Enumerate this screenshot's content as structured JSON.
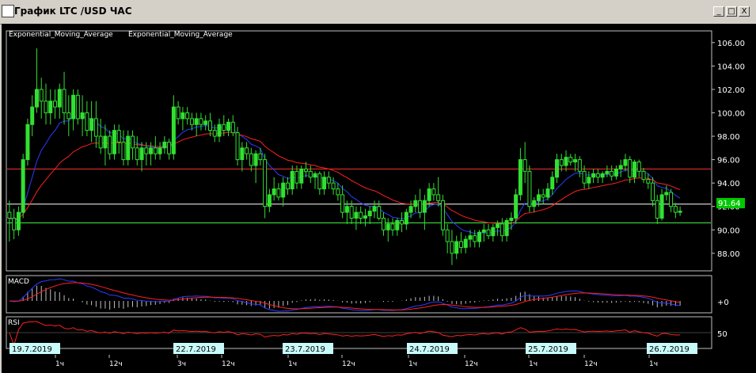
{
  "window": {
    "title": "График LTC /USD  ЧАС",
    "buttons": [
      "_",
      "□",
      "X"
    ]
  },
  "main_panel": {
    "legend": [
      {
        "name": "Exponential_Moving_Average",
        "color": "#2a3cff"
      },
      {
        "name": "Exponential_Moving_Average",
        "color": "#ff2020"
      }
    ],
    "y_ticks": [
      "106.00",
      "104.00",
      "102.00",
      "100.00",
      "98.00",
      "96.00",
      "94.00",
      "92.00",
      "90.00",
      "88.00"
    ],
    "current_price": "91.64",
    "hlines": [
      {
        "value": 95.2,
        "color": "#ff3030"
      },
      {
        "value": 92.2,
        "color": "#ffffff"
      },
      {
        "value": 90.6,
        "color": "#40ff40"
      }
    ]
  },
  "macd_panel": {
    "label": "MACD",
    "tick": "+0"
  },
  "rsi_panel": {
    "label": "RSI",
    "tick": "50"
  },
  "x_axis": {
    "dates": [
      "19.7.2019",
      "22.7.2019",
      "23.7.2019",
      "24.7.2019",
      "25.7.2019",
      "26.7.2019"
    ],
    "times": [
      "1ч",
      "12ч",
      "3ч",
      "12ч",
      "1ч",
      "12ч",
      "1ч",
      "12ч",
      "1ч",
      "12ч",
      "1ч"
    ]
  },
  "chart_data": {
    "type": "candlestick",
    "ylim": [
      86.5,
      107
    ],
    "candles": [
      [
        91.5,
        92.5,
        89.0,
        91.0
      ],
      [
        91.0,
        91.8,
        89.2,
        90.0
      ],
      [
        90.0,
        92.0,
        89.5,
        91.5
      ],
      [
        91.5,
        96.5,
        91.0,
        96.0
      ],
      [
        96.0,
        99.5,
        95.5,
        99.0
      ],
      [
        99.0,
        101.5,
        98.0,
        100.5
      ],
      [
        100.5,
        105.5,
        100.0,
        102.0
      ],
      [
        102.0,
        103.0,
        99.5,
        101.0
      ],
      [
        101.0,
        102.5,
        99.0,
        100.0
      ],
      [
        100.0,
        102.0,
        99.0,
        101.0
      ],
      [
        101.0,
        102.0,
        99.5,
        100.5
      ],
      [
        100.5,
        102.5,
        99.5,
        102.0
      ],
      [
        102.0,
        103.5,
        99.0,
        100.0
      ],
      [
        100.0,
        101.5,
        98.0,
        99.5
      ],
      [
        99.5,
        102.0,
        98.5,
        101.5
      ],
      [
        101.5,
        102.0,
        99.0,
        99.5
      ],
      [
        99.5,
        101.5,
        98.0,
        100.0
      ],
      [
        100.0,
        101.0,
        98.0,
        98.5
      ],
      [
        98.5,
        101.0,
        97.5,
        99.5
      ],
      [
        99.5,
        101.0,
        97.0,
        98.0
      ],
      [
        98.0,
        99.5,
        96.5,
        97.0
      ],
      [
        97.0,
        99.0,
        95.5,
        98.0
      ],
      [
        98.0,
        98.5,
        96.0,
        96.5
      ],
      [
        96.5,
        99.0,
        96.0,
        98.5
      ],
      [
        98.5,
        99.0,
        96.5,
        97.5
      ],
      [
        97.5,
        98.5,
        95.5,
        96.0
      ],
      [
        96.0,
        98.5,
        95.5,
        98.0
      ],
      [
        98.0,
        98.5,
        96.0,
        97.0
      ],
      [
        97.0,
        98.0,
        95.5,
        96.0
      ],
      [
        96.0,
        97.5,
        95.0,
        97.0
      ],
      [
        97.0,
        97.5,
        95.5,
        96.5
      ],
      [
        96.5,
        97.5,
        95.5,
        97.0
      ],
      [
        97.0,
        98.0,
        96.0,
        96.5
      ],
      [
        96.5,
        97.5,
        96.0,
        97.0
      ],
      [
        97.0,
        98.0,
        96.5,
        97.5
      ],
      [
        97.5,
        97.8,
        96.0,
        96.5
      ],
      [
        96.5,
        101.5,
        96.0,
        100.5
      ],
      [
        100.5,
        101.0,
        99.0,
        99.5
      ],
      [
        99.5,
        100.5,
        98.5,
        100.0
      ],
      [
        100.0,
        100.5,
        99.0,
        99.5
      ],
      [
        99.5,
        100.0,
        98.5,
        99.0
      ],
      [
        99.0,
        100.0,
        98.0,
        99.5
      ],
      [
        99.5,
        100.0,
        98.5,
        99.0
      ],
      [
        99.0,
        99.8,
        98.5,
        99.3
      ],
      [
        99.3,
        100.0,
        98.0,
        98.5
      ],
      [
        98.5,
        99.0,
        97.5,
        98.0
      ],
      [
        98.0,
        99.5,
        97.5,
        99.0
      ],
      [
        99.0,
        99.8,
        98.0,
        98.5
      ],
      [
        98.5,
        99.5,
        98.0,
        99.2
      ],
      [
        99.2,
        99.8,
        98.0,
        98.3
      ],
      [
        98.3,
        98.8,
        95.5,
        96.0
      ],
      [
        96.0,
        97.5,
        95.0,
        97.0
      ],
      [
        97.0,
        97.5,
        96.0,
        96.5
      ],
      [
        96.5,
        97.0,
        95.0,
        95.5
      ],
      [
        95.5,
        96.8,
        94.0,
        96.5
      ],
      [
        96.5,
        97.0,
        95.5,
        96.0
      ],
      [
        96.0,
        96.5,
        91.0,
        92.0
      ],
      [
        92.0,
        93.5,
        91.5,
        93.0
      ],
      [
        93.0,
        94.5,
        92.5,
        93.5
      ],
      [
        93.5,
        94.0,
        92.5,
        92.8
      ],
      [
        92.8,
        94.5,
        92.0,
        94.0
      ],
      [
        94.0,
        94.5,
        93.0,
        93.5
      ],
      [
        93.5,
        95.5,
        93.0,
        95.0
      ],
      [
        95.0,
        95.5,
        93.5,
        94.0
      ],
      [
        94.0,
        95.5,
        93.5,
        95.2
      ],
      [
        95.2,
        95.8,
        94.5,
        95.0
      ],
      [
        95.0,
        95.5,
        94.0,
        94.5
      ],
      [
        94.5,
        95.0,
        93.5,
        94.8
      ],
      [
        94.8,
        95.0,
        93.0,
        93.5
      ],
      [
        93.5,
        95.0,
        93.0,
        94.5
      ],
      [
        94.5,
        95.0,
        93.5,
        94.0
      ],
      [
        94.0,
        94.5,
        93.0,
        93.5
      ],
      [
        93.5,
        94.0,
        92.5,
        93.0
      ],
      [
        93.0,
        93.8,
        91.0,
        91.5
      ],
      [
        91.5,
        92.5,
        90.5,
        92.0
      ],
      [
        92.0,
        92.5,
        90.5,
        91.0
      ],
      [
        91.0,
        92.0,
        90.0,
        91.5
      ],
      [
        91.5,
        92.0,
        90.5,
        91.0
      ],
      [
        91.0,
        91.8,
        90.3,
        91.2
      ],
      [
        91.2,
        92.0,
        90.5,
        91.6
      ],
      [
        91.6,
        92.5,
        91.0,
        92.0
      ],
      [
        92.0,
        92.5,
        90.8,
        91.0
      ],
      [
        91.0,
        91.5,
        89.5,
        90.0
      ],
      [
        90.0,
        91.0,
        89.0,
        90.5
      ],
      [
        90.5,
        91.0,
        89.5,
        90.0
      ],
      [
        90.0,
        91.0,
        89.5,
        90.8
      ],
      [
        90.8,
        91.5,
        89.8,
        90.5
      ],
      [
        90.5,
        91.8,
        90.0,
        91.5
      ],
      [
        91.5,
        92.5,
        91.0,
        92.0
      ],
      [
        92.0,
        93.0,
        91.5,
        92.5
      ],
      [
        92.5,
        93.5,
        91.0,
        91.5
      ],
      [
        91.5,
        93.0,
        90.0,
        92.5
      ],
      [
        92.5,
        94.0,
        92.0,
        93.5
      ],
      [
        93.5,
        94.0,
        92.5,
        93.0
      ],
      [
        93.0,
        94.5,
        92.0,
        92.5
      ],
      [
        92.5,
        93.0,
        89.5,
        90.0
      ],
      [
        90.0,
        90.5,
        88.0,
        89.0
      ],
      [
        89.0,
        90.0,
        87.0,
        88.0
      ],
      [
        88.0,
        89.5,
        87.5,
        89.0
      ],
      [
        89.0,
        89.8,
        88.0,
        88.5
      ],
      [
        88.5,
        89.5,
        88.0,
        89.2
      ],
      [
        89.2,
        90.0,
        88.5,
        89.5
      ],
      [
        89.5,
        90.0,
        88.5,
        89.0
      ],
      [
        89.0,
        90.0,
        88.5,
        89.8
      ],
      [
        89.8,
        90.5,
        89.0,
        90.0
      ],
      [
        90.0,
        90.5,
        89.2,
        89.5
      ],
      [
        89.5,
        90.5,
        89.0,
        90.2
      ],
      [
        90.2,
        90.8,
        89.5,
        90.5
      ],
      [
        90.5,
        91.0,
        89.0,
        89.5
      ],
      [
        89.5,
        91.0,
        89.0,
        90.8
      ],
      [
        90.8,
        91.5,
        90.0,
        91.0
      ],
      [
        91.0,
        93.5,
        90.5,
        93.0
      ],
      [
        93.0,
        97.0,
        92.5,
        96.0
      ],
      [
        96.0,
        97.5,
        94.0,
        95.0
      ],
      [
        95.0,
        95.5,
        91.5,
        92.0
      ],
      [
        92.0,
        92.8,
        91.5,
        92.5
      ],
      [
        92.5,
        93.5,
        92.0,
        93.0
      ],
      [
        93.0,
        93.5,
        92.2,
        92.8
      ],
      [
        92.8,
        94.0,
        92.5,
        93.5
      ],
      [
        93.5,
        95.0,
        93.0,
        94.5
      ],
      [
        94.5,
        96.5,
        94.0,
        96.0
      ],
      [
        96.0,
        96.5,
        95.0,
        95.5
      ],
      [
        95.5,
        96.8,
        95.0,
        96.2
      ],
      [
        96.2,
        96.5,
        95.5,
        95.8
      ],
      [
        95.8,
        96.5,
        95.0,
        96.0
      ],
      [
        96.0,
        96.3,
        94.5,
        95.0
      ],
      [
        95.0,
        95.5,
        93.5,
        94.0
      ],
      [
        94.0,
        95.0,
        93.5,
        94.5
      ],
      [
        94.5,
        95.2,
        94.0,
        94.8
      ],
      [
        94.8,
        95.2,
        94.0,
        94.5
      ],
      [
        94.5,
        95.0,
        94.0,
        94.8
      ],
      [
        94.8,
        95.5,
        94.5,
        95.0
      ],
      [
        95.0,
        95.5,
        94.2,
        94.6
      ],
      [
        94.6,
        95.5,
        94.3,
        95.2
      ],
      [
        95.2,
        96.0,
        94.5,
        95.5
      ],
      [
        95.5,
        96.5,
        95.0,
        96.0
      ],
      [
        96.0,
        96.3,
        94.0,
        94.5
      ],
      [
        94.5,
        96.0,
        94.0,
        95.8
      ],
      [
        95.8,
        96.0,
        94.5,
        95.0
      ],
      [
        95.0,
        95.3,
        94.0,
        94.3
      ],
      [
        94.3,
        94.8,
        93.5,
        94.0
      ],
      [
        94.0,
        94.5,
        92.0,
        92.5
      ],
      [
        92.5,
        93.0,
        90.5,
        91.0
      ],
      [
        91.0,
        93.5,
        90.8,
        93.0
      ],
      [
        93.0,
        93.8,
        92.5,
        93.2
      ],
      [
        93.2,
        93.5,
        91.5,
        92.0
      ],
      [
        92.0,
        92.3,
        91.0,
        91.5
      ],
      [
        91.5,
        92.0,
        91.2,
        91.6
      ]
    ]
  }
}
